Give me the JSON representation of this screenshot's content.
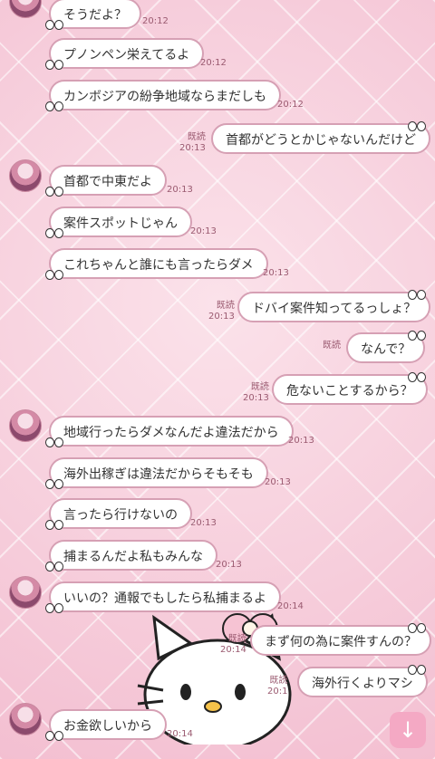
{
  "messages": [
    {
      "side": "left",
      "text": "そうだよ？",
      "time": "20:12"
    },
    {
      "side": "left",
      "text": "プノンペン栄えてるよ",
      "time": "20:12"
    },
    {
      "side": "left",
      "text": "カンボジアの紛争地域ならまだしも",
      "time": "20:12"
    },
    {
      "side": "right",
      "text": "首都がどうとかじゃないんだけど",
      "time": "20:13",
      "read": "既読"
    },
    {
      "side": "left",
      "text": "首都で中東だよ",
      "time": "20:13"
    },
    {
      "side": "left",
      "text": "案件スポットじゃん",
      "time": "20:13"
    },
    {
      "side": "left",
      "text": "これちゃんと誰にも言ったらダメ",
      "time": "20:13"
    },
    {
      "side": "right",
      "text": "ドバイ案件知ってるっしょ？",
      "time": "20:13",
      "read": "既読"
    },
    {
      "side": "right",
      "text": "なんで？",
      "time": "",
      "read": "既読"
    },
    {
      "side": "right",
      "text": "危ないことするから？",
      "time": "20:13",
      "read": "既読"
    },
    {
      "side": "left",
      "text": "地域行ったらダメなんだよ違法だから",
      "time": "20:13"
    },
    {
      "side": "left",
      "text": "海外出稼ぎは違法だからそもそも",
      "time": "20:13"
    },
    {
      "side": "left",
      "text": "言ったら行けないの",
      "time": "20:13"
    },
    {
      "side": "left",
      "text": "捕まるんだよ私もみんな",
      "time": "20:13"
    },
    {
      "side": "left",
      "text": "いいの？通報でもしたら私捕まるよ",
      "time": "20:14"
    },
    {
      "side": "right",
      "text": "まず何の為に案件すんの？",
      "time": "20:14",
      "read": "既読"
    },
    {
      "side": "right",
      "text": "海外行くよりマシ",
      "time": "20:1",
      "read": "既読"
    },
    {
      "side": "left",
      "text": "お金欲しいから",
      "time": "20:14"
    }
  ],
  "scroll_button_glyph": "↓",
  "colors": {
    "bubble_border": "#d6a0b4",
    "background": "#f6c9d8",
    "accent": "#f4a9c4"
  }
}
